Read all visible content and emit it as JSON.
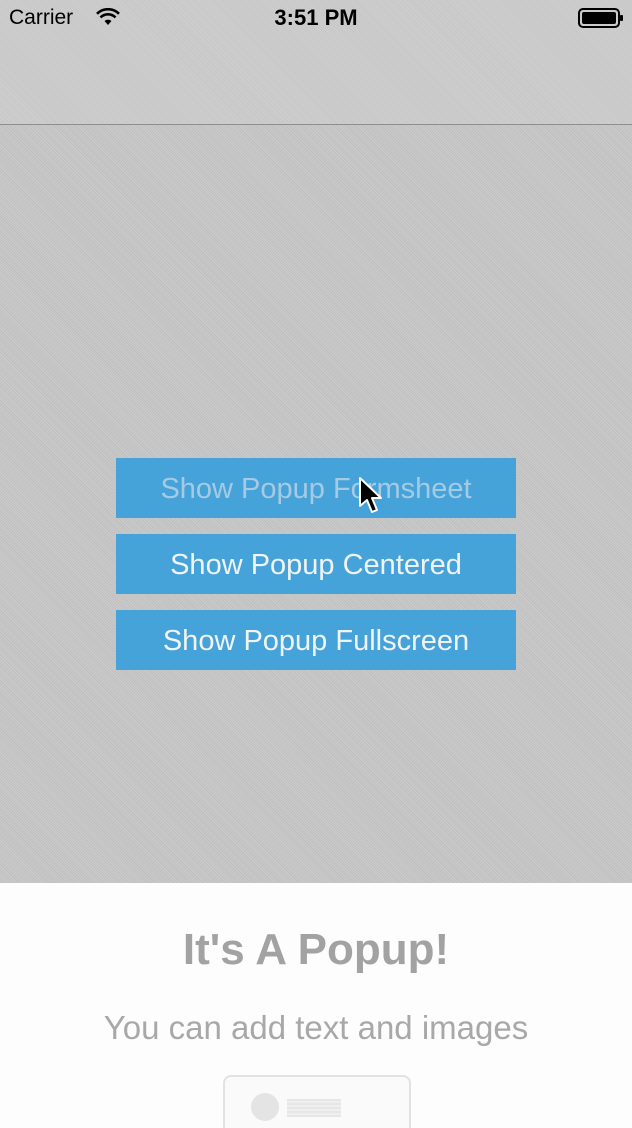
{
  "status_bar": {
    "carrier": "Carrier",
    "time": "3:51 PM",
    "icons": [
      "wifi-icon",
      "battery-icon"
    ]
  },
  "buttons": {
    "formsheet": "Show Popup Formsheet",
    "centered": "Show Popup Centered",
    "fullscreen": "Show Popup Fullscreen"
  },
  "popup": {
    "title": "It's A Popup!",
    "subtitle": "You can add text and images"
  },
  "colors": {
    "button_bg": "#45a3d9",
    "background": "#c6c6c6",
    "popup_bg": "#fdfdfd"
  }
}
